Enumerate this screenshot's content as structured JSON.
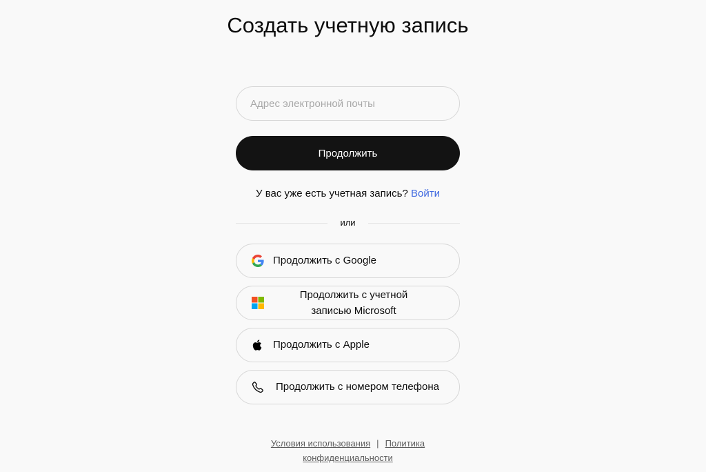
{
  "page": {
    "title": "Создать учетную запись"
  },
  "form": {
    "email_placeholder": "Адрес электронной почты",
    "email_value": "",
    "continue_label": "Продолжить"
  },
  "login": {
    "prompt": "У вас уже есть учетная запись?",
    "link_label": "Войти"
  },
  "divider": {
    "label": "или"
  },
  "social": {
    "google_label": "Продолжить с Google",
    "google_icon": "google-logo-icon",
    "microsoft_label": "Продолжить с учетной записью Microsoft",
    "microsoft_icon": "microsoft-logo-icon",
    "apple_label": "Продолжить с Apple",
    "apple_icon": "apple-logo-icon",
    "phone_label": "Продолжить с номером телефона",
    "phone_icon": "phone-icon"
  },
  "footer": {
    "terms_label": "Условия использования",
    "separator": "|",
    "privacy_label": "Политика конфиденциальности"
  },
  "colors": {
    "background": "#f9f9f9",
    "primary_button": "#131313",
    "link": "#3e68e0",
    "border": "#d7d7d7"
  }
}
